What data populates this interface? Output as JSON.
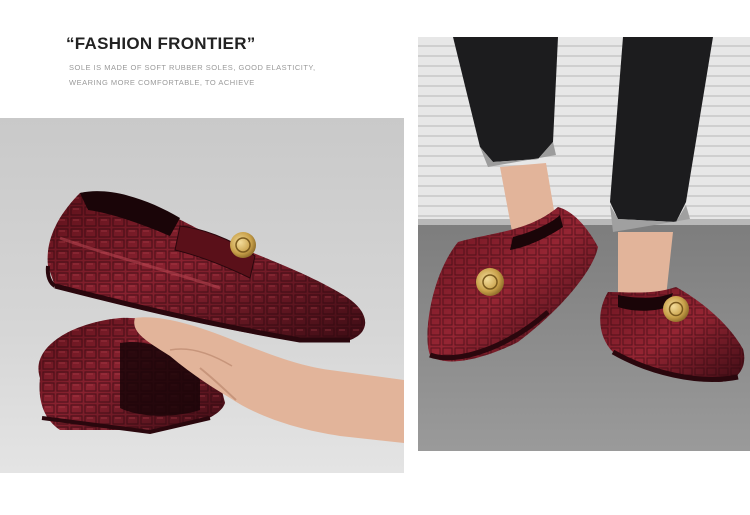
{
  "header": {
    "title": "“FASHION FRONTIER”",
    "subtitle_line1": "SOLE IS MADE OF SOFT RUBBER SOLES, GOOD ELASTICITY,",
    "subtitle_line2": "WEARING MORE COMFORTABLE, TO ACHIEVE"
  },
  "colors": {
    "leather_dark": "#3d0c14",
    "leather_mid": "#7a1a26",
    "leather_light": "#a8343f",
    "buckle_gold": "#c9a14a",
    "left_bg": "#d2d2d2",
    "floor": "#8c8c8c",
    "jeans": "#1c1c1e",
    "skin": "#e2b49a"
  },
  "images": [
    {
      "name": "hand-holding-loafers-photo"
    },
    {
      "name": "model-wearing-loafers-photo"
    }
  ]
}
